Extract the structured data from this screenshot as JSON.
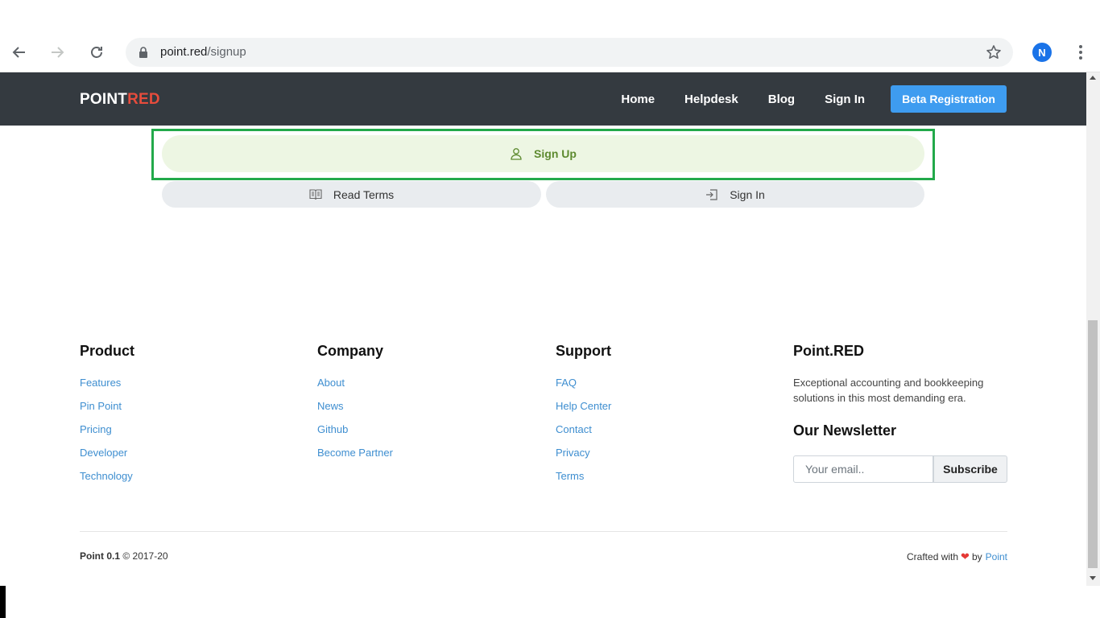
{
  "browser": {
    "url_host": "point.red",
    "url_path": "/signup",
    "profile_initial": "N",
    "icons": {
      "back": "arrow-left-icon",
      "forward": "arrow-right-icon",
      "reload": "reload-icon",
      "lock": "lock-icon",
      "bookmark": "star-icon",
      "menu": "kebab-menu-icon"
    }
  },
  "navbar": {
    "brand_primary": "POINT",
    "brand_accent": "RED",
    "links": [
      "Home",
      "Helpdesk",
      "Blog",
      "Sign In"
    ],
    "cta": "Beta Registration"
  },
  "actions": {
    "signup": "Sign Up",
    "read_terms": "Read Terms",
    "signin": "Sign In"
  },
  "footer": {
    "product": {
      "title": "Product",
      "links": [
        "Features",
        "Pin Point",
        "Pricing",
        "Developer",
        "Technology"
      ]
    },
    "company": {
      "title": "Company",
      "links": [
        "About",
        "News",
        "Github",
        "Become Partner"
      ]
    },
    "support": {
      "title": "Support",
      "links": [
        "FAQ",
        "Help Center",
        "Contact",
        "Privacy",
        "Terms"
      ]
    },
    "about": {
      "title": "Point.RED",
      "description": "Exceptional accounting and bookkeeping solutions in this most demanding era.",
      "newsletter_title": "Our Newsletter",
      "email_placeholder": "Your email..",
      "subscribe": "Subscribe"
    },
    "copyright_version": "Point 0.1",
    "copyright_rest": "© 2017-20",
    "crafted_prefix": "Crafted with",
    "crafted_by": "by",
    "crafted_author": "Point"
  },
  "colors": {
    "navbar_bg": "#343a40",
    "brand_accent": "#e74c3c",
    "cta_bg": "#3e9cf0",
    "signup_bg": "#edf6e3",
    "signup_text": "#5d8a2f",
    "highlight_border": "#22a94a",
    "link": "#3e8ed0"
  }
}
